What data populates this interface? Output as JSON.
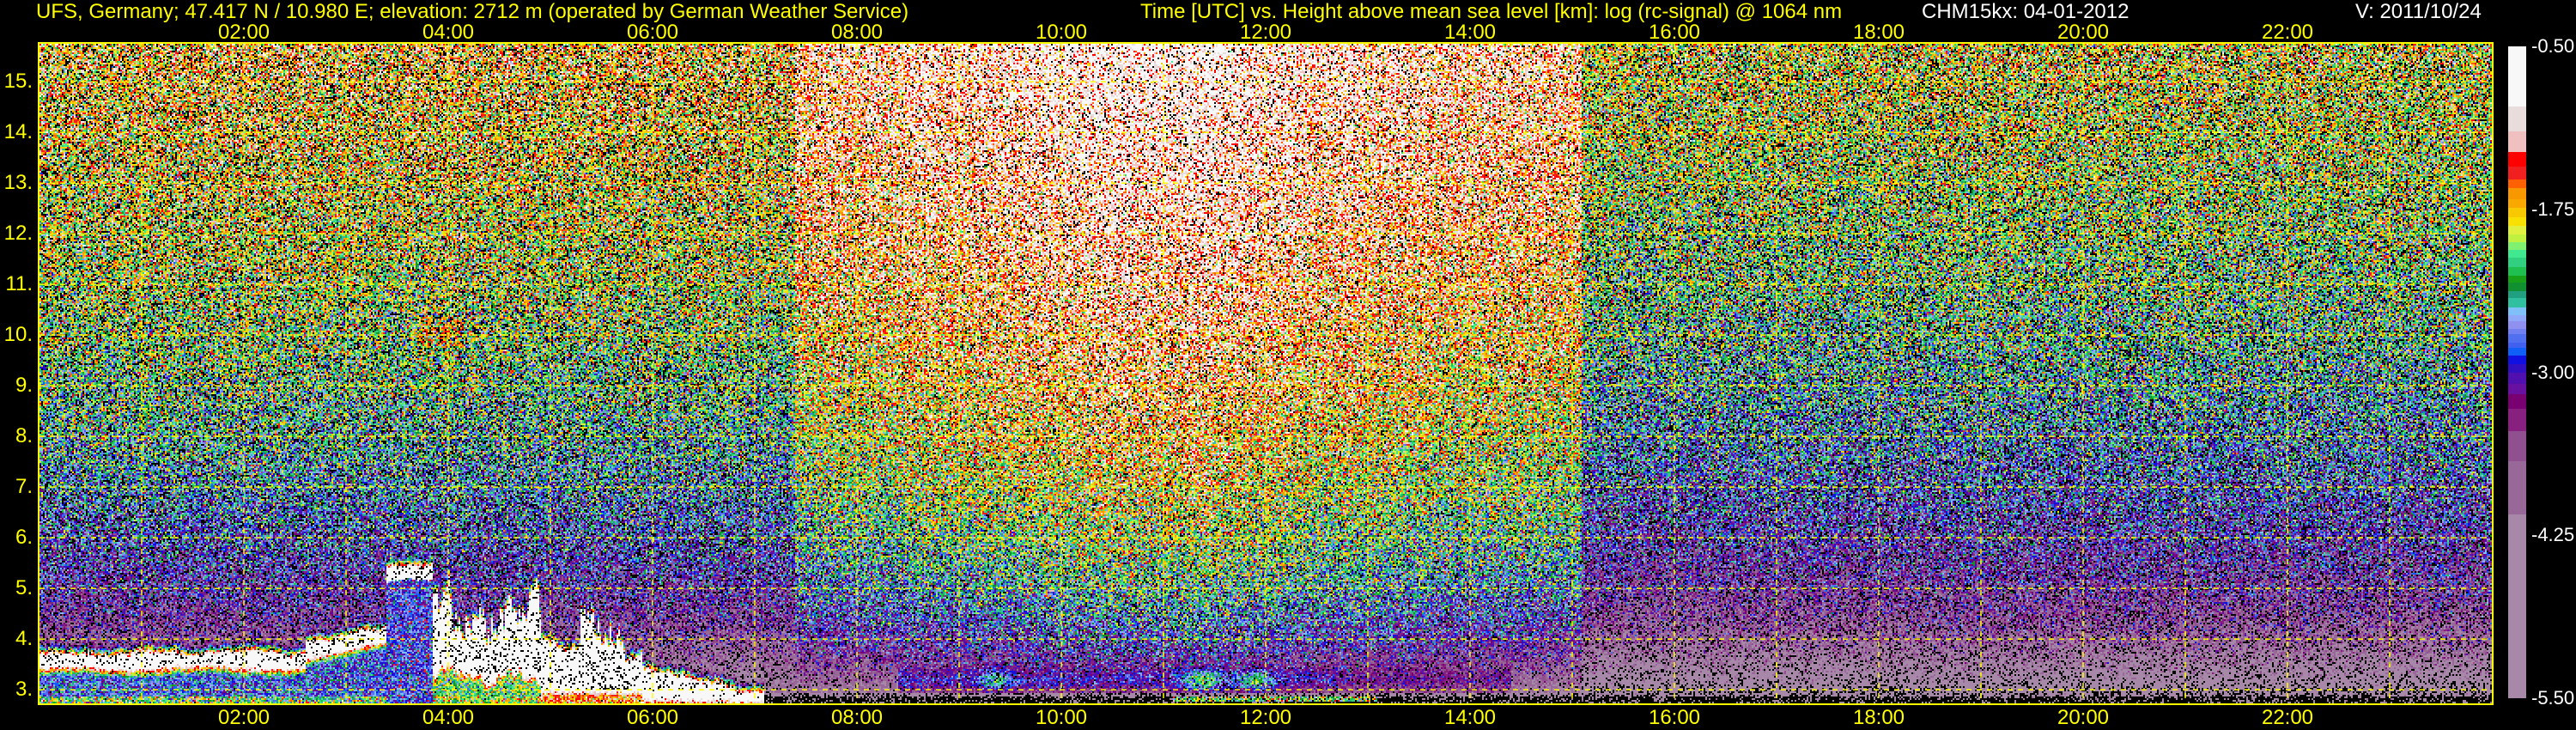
{
  "header": {
    "title_left": "UFS, Germany; 47.417 N / 10.980 E; elevation: 2712 m  (operated by German Weather Service)",
    "title_center": "Time [UTC] vs. Height above mean sea level [km]: log (rc-signal) @ 1064 nm",
    "instrument_date": "CHM15kx: 04-01-2012",
    "version": "V: 2011/10/24"
  },
  "chart_data": {
    "type": "heatmap",
    "title": "Time [UTC] vs. Height above mean sea level [km]: log (rc-signal) @ 1064 nm",
    "xlabel": "Time [UTC]",
    "ylabel": "Height above mean sea level [km]",
    "x_range": [
      0,
      24
    ],
    "y_range": [
      2.73,
      15.75
    ],
    "grid": true,
    "grid_color": "#ffff00",
    "x_ticks": [
      {
        "label": "02:00",
        "hour": 2
      },
      {
        "label": "04:00",
        "hour": 4
      },
      {
        "label": "06:00",
        "hour": 6
      },
      {
        "label": "08:00",
        "hour": 8
      },
      {
        "label": "10:00",
        "hour": 10
      },
      {
        "label": "12:00",
        "hour": 12
      },
      {
        "label": "14:00",
        "hour": 14
      },
      {
        "label": "16:00",
        "hour": 16
      },
      {
        "label": "18:00",
        "hour": 18
      },
      {
        "label": "20:00",
        "hour": 20
      },
      {
        "label": "22:00",
        "hour": 22
      }
    ],
    "y_ticks": [
      {
        "label": "3.",
        "km": 3
      },
      {
        "label": "4.",
        "km": 4
      },
      {
        "label": "5.",
        "km": 5
      },
      {
        "label": "6.",
        "km": 6
      },
      {
        "label": "7.",
        "km": 7
      },
      {
        "label": "8.",
        "km": 8
      },
      {
        "label": "9.",
        "km": 9
      },
      {
        "label": "10.",
        "km": 10
      },
      {
        "label": "11.",
        "km": 11
      },
      {
        "label": "12.",
        "km": 12
      },
      {
        "label": "13.",
        "km": 13
      },
      {
        "label": "14.",
        "km": 14
      },
      {
        "label": "15.",
        "km": 15
      }
    ],
    "colorbar": {
      "range": [
        -5.5,
        -0.5
      ],
      "ticks": [
        {
          "label": "-0.50",
          "value": -0.5
        },
        {
          "label": "-1.75",
          "value": -1.75
        },
        {
          "label": "-3.00",
          "value": -3.0
        },
        {
          "label": "-4.25",
          "value": -4.25
        },
        {
          "label": "-5.50",
          "value": -5.5
        }
      ],
      "segments": [
        {
          "from": -0.96,
          "to": -0.5,
          "color": "#f8f8f8"
        },
        {
          "from": -1.15,
          "to": -0.96,
          "color": "#e8dcdc"
        },
        {
          "from": -1.31,
          "to": -1.15,
          "color": "#f0c0c0"
        },
        {
          "from": -1.42,
          "to": -1.31,
          "color": "#ff0000"
        },
        {
          "from": -1.52,
          "to": -1.42,
          "color": "#f02020"
        },
        {
          "from": -1.59,
          "to": -1.52,
          "color": "#ff6000"
        },
        {
          "from": -1.67,
          "to": -1.59,
          "color": "#f89800"
        },
        {
          "from": -1.74,
          "to": -1.67,
          "color": "#f8a800"
        },
        {
          "from": -1.81,
          "to": -1.74,
          "color": "#f8c800"
        },
        {
          "from": -1.88,
          "to": -1.81,
          "color": "#f8e000"
        },
        {
          "from": -1.94,
          "to": -1.88,
          "color": "#e0f040"
        },
        {
          "from": -2.0,
          "to": -1.94,
          "color": "#c0f040"
        },
        {
          "from": -2.06,
          "to": -2.0,
          "color": "#80f070"
        },
        {
          "from": -2.12,
          "to": -2.06,
          "color": "#40e890"
        },
        {
          "from": -2.19,
          "to": -2.12,
          "color": "#30d080"
        },
        {
          "from": -2.26,
          "to": -2.19,
          "color": "#20c050"
        },
        {
          "from": -2.31,
          "to": -2.26,
          "color": "#18a018"
        },
        {
          "from": -2.38,
          "to": -2.31,
          "color": "#109030"
        },
        {
          "from": -2.43,
          "to": -2.38,
          "color": "#20a080"
        },
        {
          "from": -2.5,
          "to": -2.43,
          "color": "#30c0a0"
        },
        {
          "from": -2.56,
          "to": -2.5,
          "color": "#80c0f8"
        },
        {
          "from": -2.61,
          "to": -2.56,
          "color": "#90a8f8"
        },
        {
          "from": -2.67,
          "to": -2.61,
          "color": "#9090f0"
        },
        {
          "from": -2.71,
          "to": -2.67,
          "color": "#7080f0"
        },
        {
          "from": -2.77,
          "to": -2.71,
          "color": "#5070f0"
        },
        {
          "from": -2.81,
          "to": -2.77,
          "color": "#4060f0"
        },
        {
          "from": -2.87,
          "to": -2.81,
          "color": "#1060f8"
        },
        {
          "from": -2.94,
          "to": -2.87,
          "color": "#1010e0"
        },
        {
          "from": -3.0,
          "to": -2.94,
          "color": "#3010c0"
        },
        {
          "from": -3.09,
          "to": -3.0,
          "color": "#5010b0"
        },
        {
          "from": -3.17,
          "to": -3.09,
          "color": "#6810a0"
        },
        {
          "from": -3.28,
          "to": -3.17,
          "color": "#780070"
        },
        {
          "from": -3.45,
          "to": -3.28,
          "color": "#882080"
        },
        {
          "from": -3.68,
          "to": -3.45,
          "color": "#905090"
        },
        {
          "from": -4.09,
          "to": -3.68,
          "color": "#986898"
        },
        {
          "from": -5.5,
          "to": -4.09,
          "color": "#a888a8"
        }
      ]
    },
    "background_regimes": [
      {
        "start_hour": 0,
        "end_hour": 7.4,
        "condition": "night"
      },
      {
        "start_hour": 7.4,
        "end_hour": 15.1,
        "condition": "daylight"
      },
      {
        "start_hour": 15.1,
        "end_hour": 24,
        "condition": "night"
      }
    ],
    "cloud_layers": [
      {
        "start_hour": 0.0,
        "end_hour": 2.6,
        "base_km": 3.5,
        "top_km": 3.7
      },
      {
        "start_hour": 2.6,
        "end_hour": 3.4,
        "base_km": 3.6,
        "top_km": 4.0
      },
      {
        "start_hour": 3.4,
        "end_hour": 3.85,
        "base_km": 5.15,
        "top_km": 5.4
      },
      {
        "start_hour": 3.85,
        "end_hour": 4.9,
        "base_km": 3.3,
        "top_km": 5.1
      },
      {
        "start_hour": 4.9,
        "end_hour": 5.9,
        "base_km": 3.0,
        "top_km": 4.8
      },
      {
        "start_hour": 5.9,
        "end_hour": 6.8,
        "base_km": 2.85,
        "top_km": 3.2
      },
      {
        "start_hour": 6.8,
        "end_hour": 7.1,
        "base_km": 2.8,
        "top_km": 2.9
      }
    ]
  }
}
